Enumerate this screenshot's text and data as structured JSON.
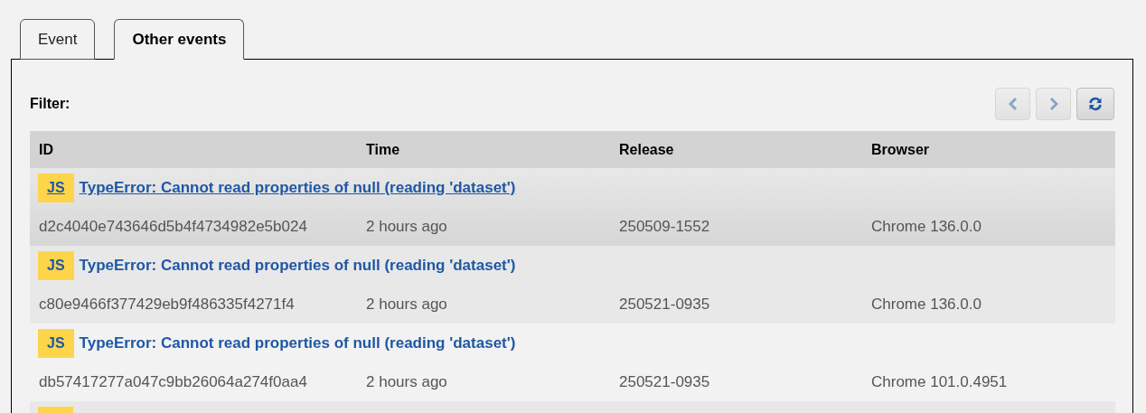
{
  "tabs": [
    {
      "label": "Event",
      "selected": false
    },
    {
      "label": "Other events",
      "selected": true
    }
  ],
  "filter": {
    "label": "Filter:"
  },
  "toolbar": {
    "buttons": [
      {
        "kind": "prev",
        "disabled": true
      },
      {
        "kind": "next",
        "disabled": true
      },
      {
        "kind": "refresh",
        "disabled": false
      }
    ]
  },
  "table": {
    "columns": [
      "ID",
      "Time",
      "Release",
      "Browser"
    ],
    "rows": [
      {
        "badge": "JS",
        "title": "TypeError: Cannot read properties of null (reading 'dataset')",
        "highlighted": true,
        "cells": [
          "d2c4040e743646d5b4f4734982e5b024",
          "2 hours ago",
          "250509-1552",
          "Chrome 136.0.0"
        ]
      },
      {
        "badge": "JS",
        "title": "TypeError: Cannot read properties of null (reading 'dataset')",
        "highlighted": false,
        "cells": [
          "c80e9466f377429eb9f486335f4271f4",
          "2 hours ago",
          "250521-0935",
          "Chrome 136.0.0"
        ]
      },
      {
        "badge": "JS",
        "title": "TypeError: Cannot read properties of null (reading 'dataset')",
        "highlighted": false,
        "cells": [
          "db57417277a047c9bb26064a274f0aa4",
          "2 hours ago",
          "250521-0935",
          "Chrome 101.0.4951"
        ]
      }
    ]
  }
}
